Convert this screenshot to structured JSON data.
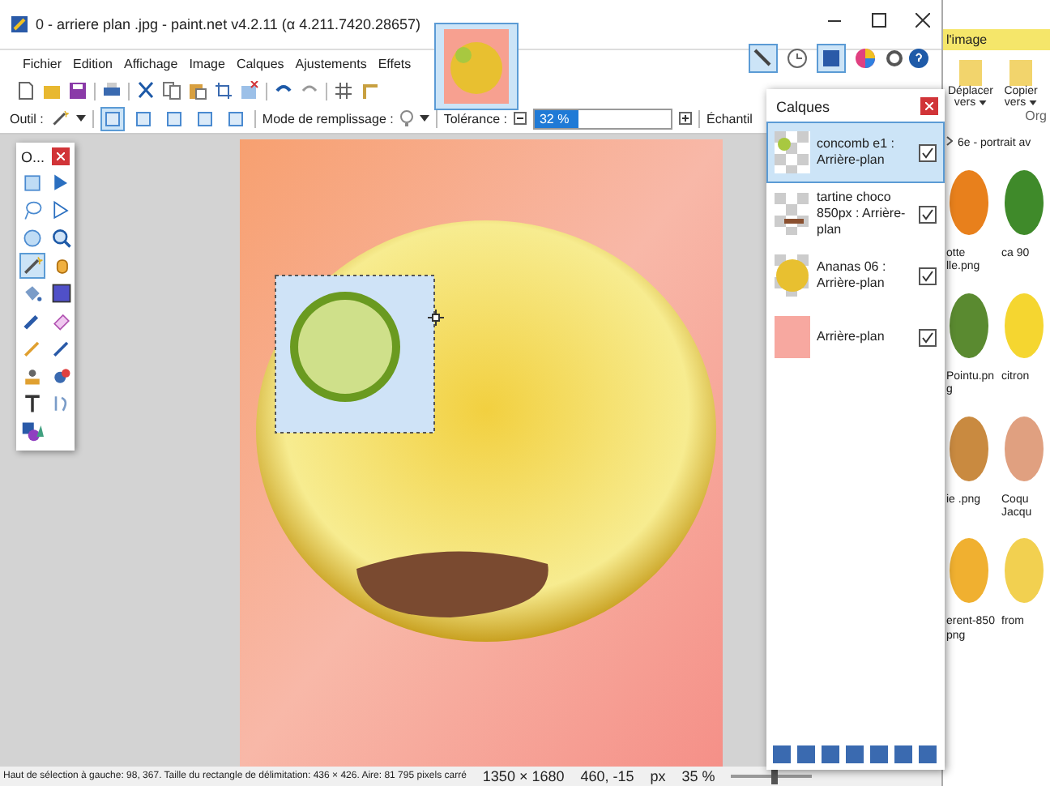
{
  "window": {
    "title": "0 - arriere plan .jpg - paint.net v4.2.11 (α 4.211.7420.28657)"
  },
  "menu": [
    "Fichier",
    "Edition",
    "Affichage",
    "Image",
    "Calques",
    "Ajustements",
    "Effets"
  ],
  "panel_toggles": [
    {
      "kind": "tools",
      "selected": true
    },
    {
      "kind": "history",
      "selected": false
    },
    {
      "kind": "layers",
      "selected": true
    },
    {
      "kind": "colors",
      "selected": false
    }
  ],
  "tool_options": {
    "tool_label": "Outil :",
    "selection_modes": [
      {
        "selected": true
      },
      {
        "selected": false
      },
      {
        "selected": false
      },
      {
        "selected": false
      },
      {
        "selected": false
      }
    ],
    "fill_mode_label": "Mode de remplissage :",
    "tolerance_label": "Tolérance :",
    "tolerance_value": "32 %",
    "tolerance": {
      "level": 0.32
    },
    "sampling_label": "Échantil"
  },
  "tools_window": {
    "title": "O...",
    "tools": [
      {
        "kind": "rect",
        "selected": false
      },
      {
        "kind": "move",
        "selected": false
      },
      {
        "kind": "lasso",
        "selected": false
      },
      {
        "kind": "move2",
        "selected": false
      },
      {
        "kind": "ellipse",
        "selected": false
      },
      {
        "kind": "zoom",
        "selected": false
      },
      {
        "kind": "wand",
        "selected": true
      },
      {
        "kind": "hand",
        "selected": false
      },
      {
        "kind": "bucket",
        "selected": false
      },
      {
        "kind": "gradient",
        "selected": false
      },
      {
        "kind": "brush",
        "selected": false
      },
      {
        "kind": "eraser",
        "selected": false
      },
      {
        "kind": "pencil",
        "selected": false
      },
      {
        "kind": "picker",
        "selected": false
      },
      {
        "kind": "stamp",
        "selected": false
      },
      {
        "kind": "recolor",
        "selected": false
      },
      {
        "kind": "text",
        "selected": false
      },
      {
        "kind": "line",
        "selected": false
      },
      {
        "kind": "shapes",
        "selected": false
      }
    ]
  },
  "layers_window": {
    "title": "Calques",
    "layers": [
      {
        "name": "concomb e1 : Arrière-plan",
        "kind": "cucumber",
        "visible": true,
        "selected": true
      },
      {
        "name": "tartine choco 850px : Arrière-plan",
        "kind": "toast",
        "visible": true,
        "selected": false
      },
      {
        "name": "Ananas 06 : Arrière-plan",
        "kind": "pineapple",
        "visible": true,
        "selected": false
      },
      {
        "name": "Arrière-plan",
        "kind": "background",
        "visible": true,
        "selected": false
      }
    ]
  },
  "status_bar": {
    "selection_info": "Haut de sélection à gauche: 98, 367. Taille du rectangle de délimitation: 436 × 426. Aire: 81 795 pixels carré",
    "image_size": "1350 × 1680",
    "cursor": "460, -15",
    "unit": "px",
    "zoom": "35 %",
    "zoom_slider": {
      "level": 0.5
    }
  },
  "explorer": {
    "ribbon_tab": "l'image",
    "actions": [
      "Déplacer vers",
      "Copier vers"
    ],
    "group_label": "Org",
    "breadcrumb": "6e - portrait av",
    "files": [
      {
        "name": "otte lle.png",
        "kind": "carrot"
      },
      {
        "name": "ca 90",
        "kind": "herb"
      },
      {
        "name": "Pointu.pn g",
        "kind": "pepper"
      },
      {
        "name": "citron",
        "kind": "lemon"
      },
      {
        "name": "ie .png",
        "kind": "cookie"
      },
      {
        "name": "Coqu Jacqu",
        "kind": "shell"
      },
      {
        "name": "erent-850 png",
        "kind": "fries"
      },
      {
        "name": "from",
        "kind": "cheese"
      }
    ]
  }
}
